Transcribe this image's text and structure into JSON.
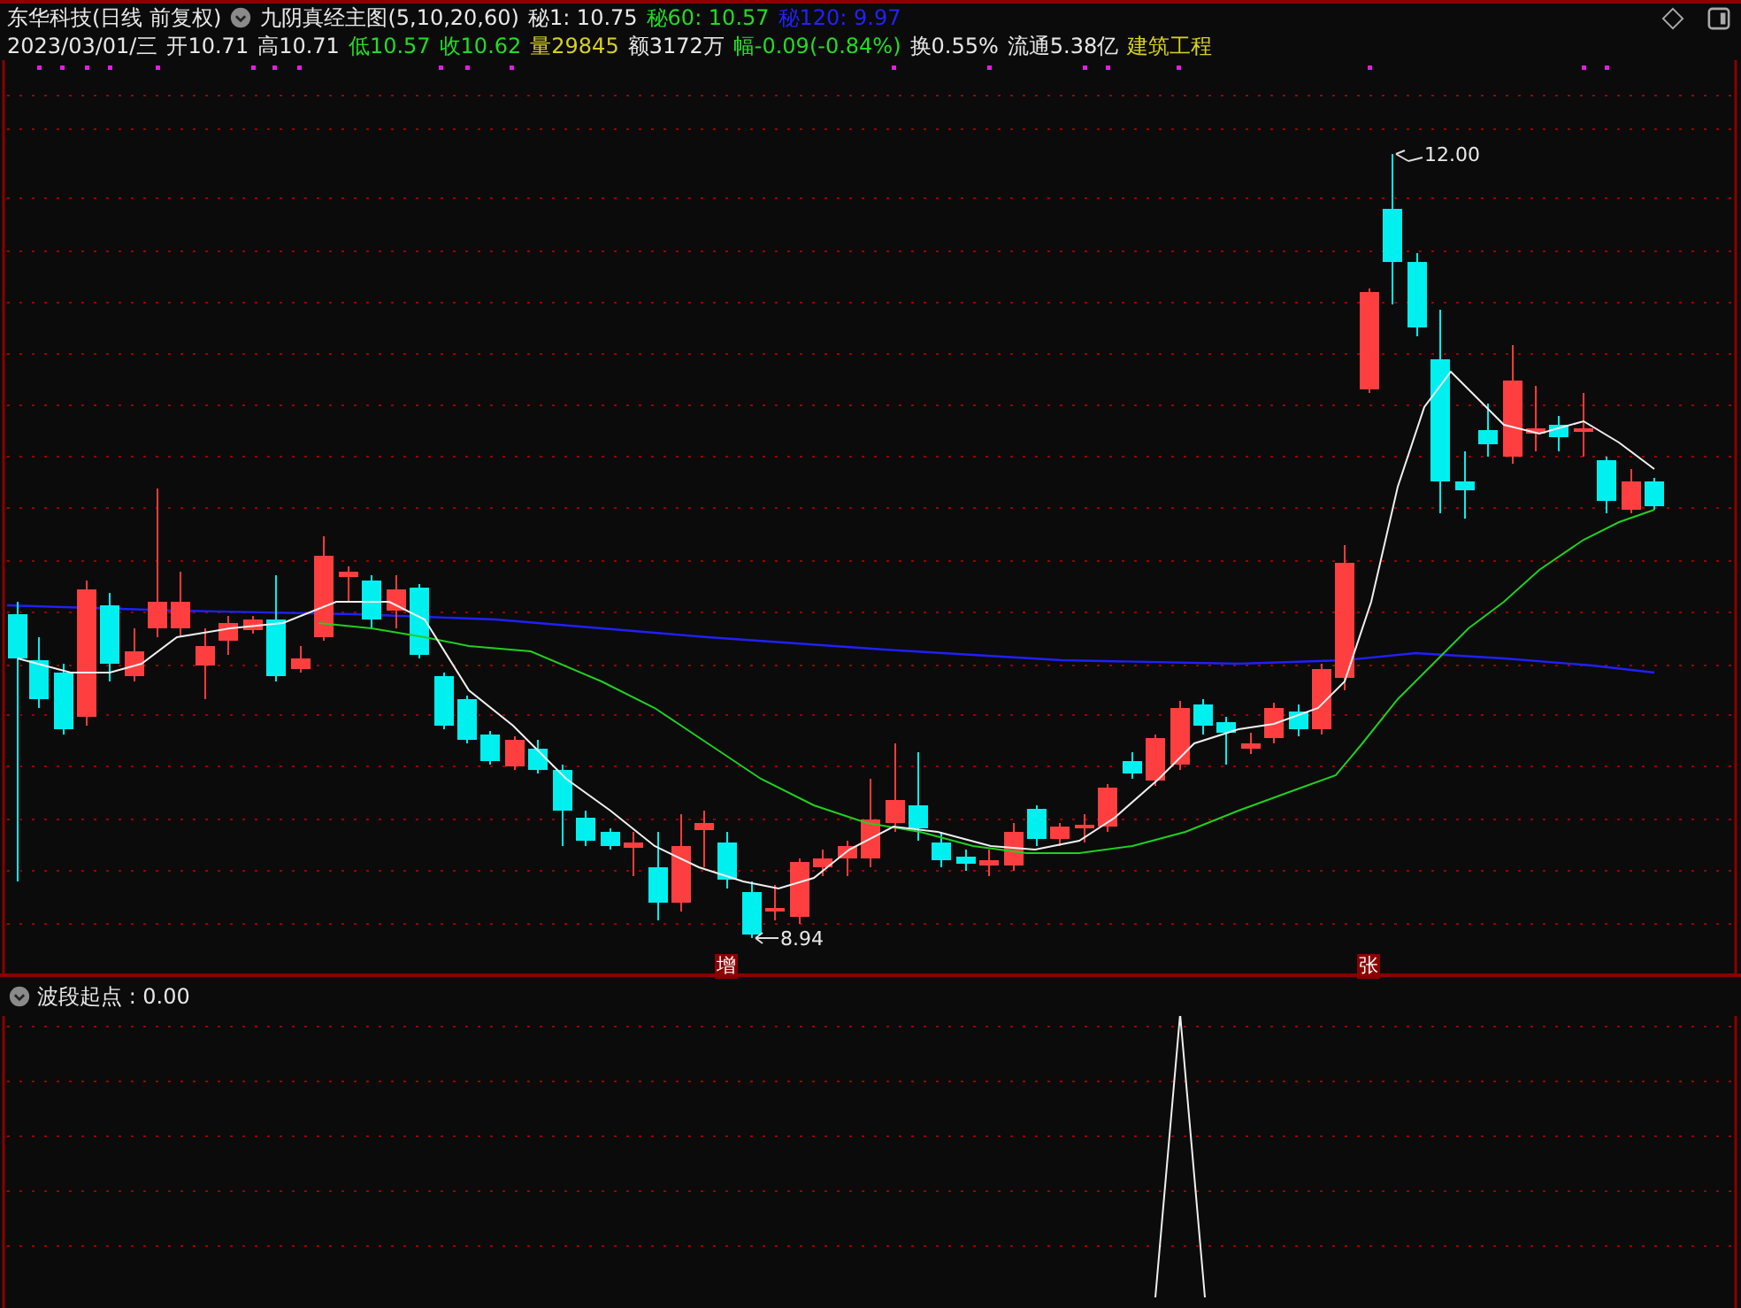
{
  "header": {
    "title": "东华科技(日线 前复权)",
    "indicator": "九阴真经主图(5,10,20,60)",
    "readings": [
      {
        "label": "秘1: 10.75",
        "color": "#e8e8e8"
      },
      {
        "label": "秘60: 10.57",
        "color": "#22dd22"
      },
      {
        "label": "秘120: 9.97",
        "color": "#2222ff"
      }
    ]
  },
  "quote": [
    {
      "text": "2023/03/01/三",
      "color": "#e8e8e8"
    },
    {
      "text": "开10.71",
      "color": "#e8e8e8"
    },
    {
      "text": "高10.71",
      "color": "#e8e8e8"
    },
    {
      "text": "低10.57",
      "color": "#22dd22"
    },
    {
      "text": "收10.62",
      "color": "#22dd22"
    },
    {
      "text": "量29845",
      "color": "#d8d020"
    },
    {
      "text": "额3172万",
      "color": "#e8e8e8"
    },
    {
      "text": "幅-0.09(-0.84%)",
      "color": "#22dd22"
    },
    {
      "text": "换0.55%",
      "color": "#e8e8e8"
    },
    {
      "text": "流通5.38亿",
      "color": "#e8e8e8"
    },
    {
      "text": "建筑工程",
      "color": "#d8d020"
    }
  ],
  "main_chart": {
    "high_label": "12.00",
    "low_label": "8.94",
    "signals": [
      "增",
      "张"
    ]
  },
  "indicator_panel": {
    "title": "波段起点 : 0.00"
  }
}
